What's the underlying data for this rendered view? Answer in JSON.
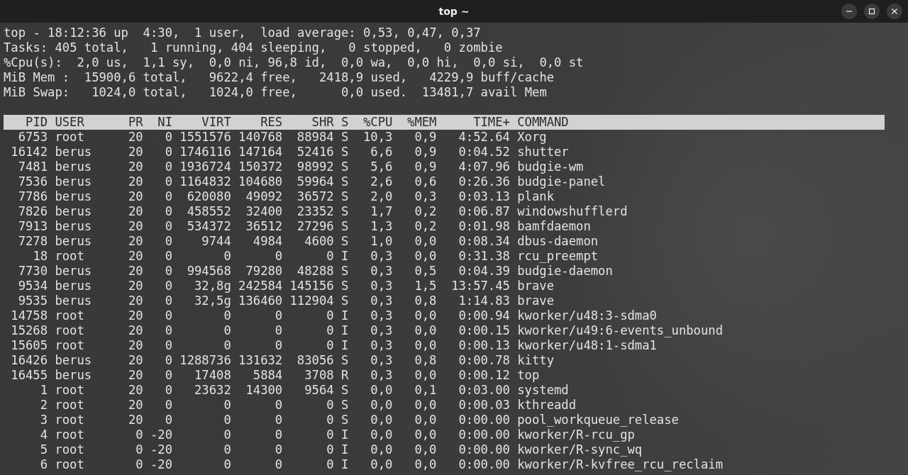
{
  "window": {
    "title": "top ~"
  },
  "summary": [
    "top - 18:12:36 up  4:30,  1 user,  load average: 0,53, 0,47, 0,37",
    "Tasks: 405 total,   1 running, 404 sleeping,   0 stopped,   0 zombie",
    "%Cpu(s):  2,0 us,  1,1 sy,  0,0 ni, 96,8 id,  0,0 wa,  0,0 hi,  0,0 si,  0,0 st",
    "MiB Mem :  15900,6 total,   9622,4 free,   2418,9 used,   4229,9 buff/cache",
    "MiB Swap:   1024,0 total,   1024,0 free,      0,0 used.  13481,7 avail Mem"
  ],
  "table": {
    "columns": [
      "PID",
      "USER",
      "PR",
      "NI",
      "VIRT",
      "RES",
      "SHR",
      "S",
      "%CPU",
      "%MEM",
      "TIME+",
      "COMMAND"
    ],
    "rows": [
      [
        "6753",
        "root",
        "20",
        "0",
        "1551576",
        "140768",
        "88984",
        "S",
        "10,3",
        "0,9",
        "4:52.64",
        "Xorg"
      ],
      [
        "16142",
        "berus",
        "20",
        "0",
        "1746116",
        "147164",
        "52416",
        "S",
        "6,6",
        "0,9",
        "0:04.52",
        "shutter"
      ],
      [
        "7481",
        "berus",
        "20",
        "0",
        "1936724",
        "150372",
        "98992",
        "S",
        "5,6",
        "0,9",
        "4:07.96",
        "budgie-wm"
      ],
      [
        "7536",
        "berus",
        "20",
        "0",
        "1164832",
        "104680",
        "59964",
        "S",
        "2,6",
        "0,6",
        "0:26.36",
        "budgie-panel"
      ],
      [
        "7786",
        "berus",
        "20",
        "0",
        "620080",
        "49092",
        "36572",
        "S",
        "2,0",
        "0,3",
        "0:03.13",
        "plank"
      ],
      [
        "7826",
        "berus",
        "20",
        "0",
        "458552",
        "32400",
        "23352",
        "S",
        "1,7",
        "0,2",
        "0:06.87",
        "windowshufflerd"
      ],
      [
        "7913",
        "berus",
        "20",
        "0",
        "534372",
        "36512",
        "27296",
        "S",
        "1,3",
        "0,2",
        "0:01.98",
        "bamfdaemon"
      ],
      [
        "7278",
        "berus",
        "20",
        "0",
        "9744",
        "4984",
        "4600",
        "S",
        "1,0",
        "0,0",
        "0:08.34",
        "dbus-daemon"
      ],
      [
        "18",
        "root",
        "20",
        "0",
        "0",
        "0",
        "0",
        "I",
        "0,3",
        "0,0",
        "0:31.38",
        "rcu_preempt"
      ],
      [
        "7730",
        "berus",
        "20",
        "0",
        "994568",
        "79280",
        "48288",
        "S",
        "0,3",
        "0,5",
        "0:04.39",
        "budgie-daemon"
      ],
      [
        "9534",
        "berus",
        "20",
        "0",
        "32,8g",
        "242584",
        "145156",
        "S",
        "0,3",
        "1,5",
        "13:57.45",
        "brave"
      ],
      [
        "9535",
        "berus",
        "20",
        "0",
        "32,5g",
        "136460",
        "112904",
        "S",
        "0,3",
        "0,8",
        "1:14.83",
        "brave"
      ],
      [
        "14758",
        "root",
        "20",
        "0",
        "0",
        "0",
        "0",
        "I",
        "0,3",
        "0,0",
        "0:00.94",
        "kworker/u48:3-sdma0"
      ],
      [
        "15268",
        "root",
        "20",
        "0",
        "0",
        "0",
        "0",
        "I",
        "0,3",
        "0,0",
        "0:00.15",
        "kworker/u49:6-events_unbound"
      ],
      [
        "15605",
        "root",
        "20",
        "0",
        "0",
        "0",
        "0",
        "I",
        "0,3",
        "0,0",
        "0:00.13",
        "kworker/u48:1-sdma1"
      ],
      [
        "16426",
        "berus",
        "20",
        "0",
        "1288736",
        "131632",
        "83056",
        "S",
        "0,3",
        "0,8",
        "0:00.78",
        "kitty"
      ],
      [
        "16455",
        "berus",
        "20",
        "0",
        "17408",
        "5884",
        "3708",
        "R",
        "0,3",
        "0,0",
        "0:00.12",
        "top"
      ],
      [
        "1",
        "root",
        "20",
        "0",
        "23632",
        "14300",
        "9564",
        "S",
        "0,0",
        "0,1",
        "0:03.00",
        "systemd"
      ],
      [
        "2",
        "root",
        "20",
        "0",
        "0",
        "0",
        "0",
        "S",
        "0,0",
        "0,0",
        "0:00.03",
        "kthreadd"
      ],
      [
        "3",
        "root",
        "20",
        "0",
        "0",
        "0",
        "0",
        "S",
        "0,0",
        "0,0",
        "0:00.00",
        "pool_workqueue_release"
      ],
      [
        "4",
        "root",
        "0",
        "-20",
        "0",
        "0",
        "0",
        "I",
        "0,0",
        "0,0",
        "0:00.00",
        "kworker/R-rcu_gp"
      ],
      [
        "5",
        "root",
        "0",
        "-20",
        "0",
        "0",
        "0",
        "I",
        "0,0",
        "0,0",
        "0:00.00",
        "kworker/R-sync_wq"
      ],
      [
        "6",
        "root",
        "0",
        "-20",
        "0",
        "0",
        "0",
        "I",
        "0,0",
        "0,0",
        "0:00.00",
        "kworker/R-kvfree_rcu_reclaim"
      ]
    ]
  }
}
